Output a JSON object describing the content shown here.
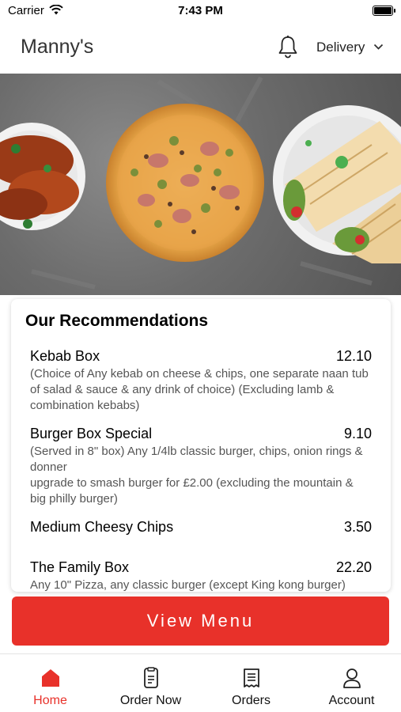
{
  "status_bar": {
    "carrier": "Carrier",
    "time": "7:43 PM"
  },
  "header": {
    "title": "Manny's",
    "order_type": "Delivery"
  },
  "recommendations": {
    "title": "Our Recommendations",
    "items": [
      {
        "name": "Kebab Box",
        "price": "12.10",
        "description": "(Choice of Any kebab on cheese & chips, one separate naan tub of salad & sauce & any drink of choice) (Excluding lamb & combination kebabs)"
      },
      {
        "name": "Burger Box Special",
        "price": "9.10",
        "description": "(Served in 8\" box) Any 1/4lb classic burger, chips, onion rings & donner\nupgrade to smash burger for £2.00 (excluding the mountain & big philly burger)"
      },
      {
        "name": "Medium Cheesy Chips",
        "price": "3.50",
        "description": ""
      },
      {
        "name": "The Family Box",
        "price": "22.20",
        "description": "Any 10\" Pizza, any classic burger (except King kong burger)"
      }
    ]
  },
  "view_menu_label": "View Menu",
  "tabs": [
    {
      "label": "Home",
      "icon": "home-icon",
      "active": true
    },
    {
      "label": "Order Now",
      "icon": "order-icon",
      "active": false
    },
    {
      "label": "Orders",
      "icon": "receipt-icon",
      "active": false
    },
    {
      "label": "Account",
      "icon": "person-icon",
      "active": false
    }
  ],
  "colors": {
    "accent": "#e8312a"
  }
}
